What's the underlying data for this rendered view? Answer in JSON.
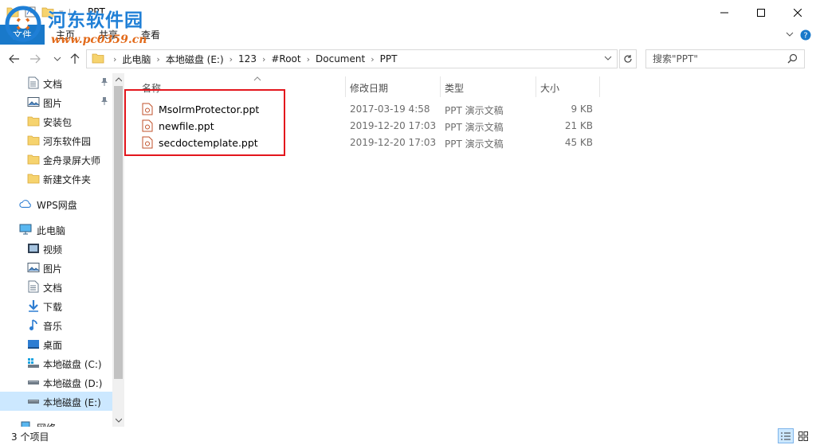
{
  "window": {
    "title": "PPT"
  },
  "watermark": {
    "name": "河东软件园",
    "url": "www.pc0359.cn"
  },
  "ribbon": {
    "file_tab": "文件",
    "tabs": [
      "主页",
      "共享",
      "查看"
    ]
  },
  "address": {
    "breadcrumbs": [
      "此电脑",
      "本地磁盘 (E:)",
      "123",
      "#Root",
      "Document",
      "PPT"
    ],
    "search_placeholder": "搜索\"PPT\""
  },
  "navpane": {
    "items": [
      {
        "label": "文档",
        "icon": "document-icon",
        "pinned": true
      },
      {
        "label": "图片",
        "icon": "pictures-icon",
        "pinned": true
      },
      {
        "label": "安装包",
        "icon": "folder-icon",
        "pinned": false
      },
      {
        "label": "河东软件园",
        "icon": "folder-icon",
        "pinned": false
      },
      {
        "label": "金舟录屏大师",
        "icon": "folder-icon",
        "pinned": false
      },
      {
        "label": "新建文件夹",
        "icon": "folder-icon",
        "pinned": false
      },
      {
        "label": "WPS网盘",
        "icon": "cloud-icon",
        "pinned": false
      },
      {
        "label": "此电脑",
        "icon": "computer-icon",
        "pinned": false
      },
      {
        "label": "视频",
        "icon": "video-icon",
        "pinned": false
      },
      {
        "label": "图片",
        "icon": "pictures-icon",
        "pinned": false
      },
      {
        "label": "文档",
        "icon": "document-icon",
        "pinned": false
      },
      {
        "label": "下载",
        "icon": "download-icon",
        "pinned": false
      },
      {
        "label": "音乐",
        "icon": "music-icon",
        "pinned": false
      },
      {
        "label": "桌面",
        "icon": "desktop-icon",
        "pinned": false
      },
      {
        "label": "本地磁盘 (C:)",
        "icon": "drive-c-icon",
        "pinned": false
      },
      {
        "label": "本地磁盘 (D:)",
        "icon": "drive-icon",
        "pinned": false
      },
      {
        "label": "本地磁盘 (E:)",
        "icon": "drive-icon",
        "pinned": false,
        "selected": true
      },
      {
        "label": "网络",
        "icon": "network-icon",
        "pinned": false
      }
    ]
  },
  "filelist": {
    "columns": {
      "name": "名称",
      "date": "修改日期",
      "type": "类型",
      "size": "大小"
    },
    "files": [
      {
        "name": "MsoIrmProtector.ppt",
        "date": "2017-03-19 4:58",
        "type": "PPT 演示文稿",
        "size": "9 KB"
      },
      {
        "name": "newfile.ppt",
        "date": "2019-12-20 17:03",
        "type": "PPT 演示文稿",
        "size": "21 KB"
      },
      {
        "name": "secdoctemplate.ppt",
        "date": "2019-12-20 17:03",
        "type": "PPT 演示文稿",
        "size": "45 KB"
      }
    ]
  },
  "status": {
    "count": "3 个项目"
  },
  "colors": {
    "accent": "#1979ca",
    "selected": "#cce8ff",
    "highlight_box": "#e3161d"
  }
}
